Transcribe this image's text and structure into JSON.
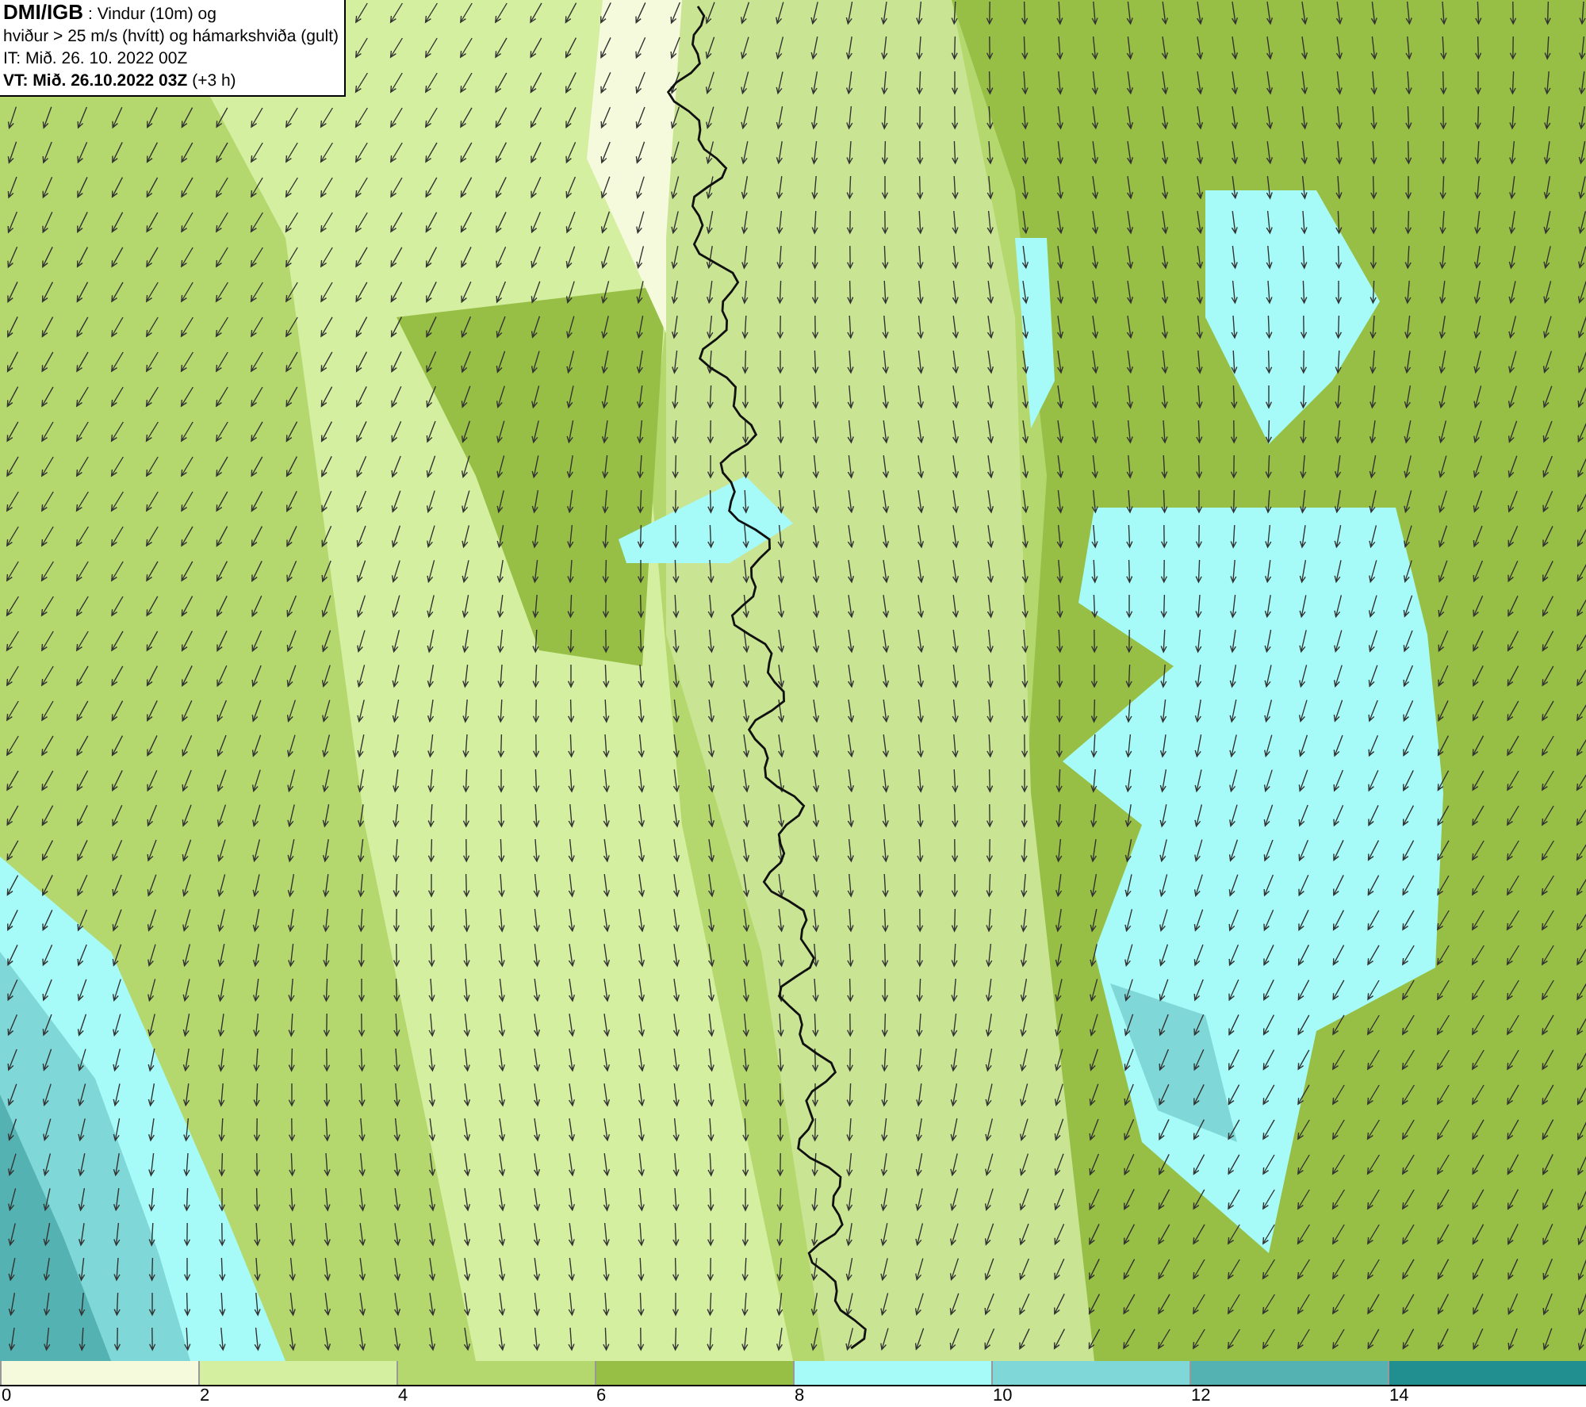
{
  "title_box": {
    "lines": [
      "**DMI/IGB** : Vindur (10m) og",
      "hviður > 25 m/s (hvítt) og hámarkshviða (gult)",
      "IT: Mið. 26. 10. 2022 00Z",
      "**VT: Mið. 26.10.2022 03Z** (+3 h)"
    ]
  },
  "color_scale": [
    {
      "label": "0",
      "color": "#f5fadc"
    },
    {
      "label": "2",
      "color": "#d5efa0"
    },
    {
      "label": "4",
      "color": "#b4d86e"
    },
    {
      "label": "6",
      "color": "#97bf45"
    },
    {
      "label": "8",
      "color": "#a6fbf8"
    },
    {
      "label": "10",
      "color": "#7fd7d7"
    },
    {
      "label": "12",
      "color": "#55b2b2"
    },
    {
      "label": "14",
      "color": "#218f8f"
    }
  ]
}
